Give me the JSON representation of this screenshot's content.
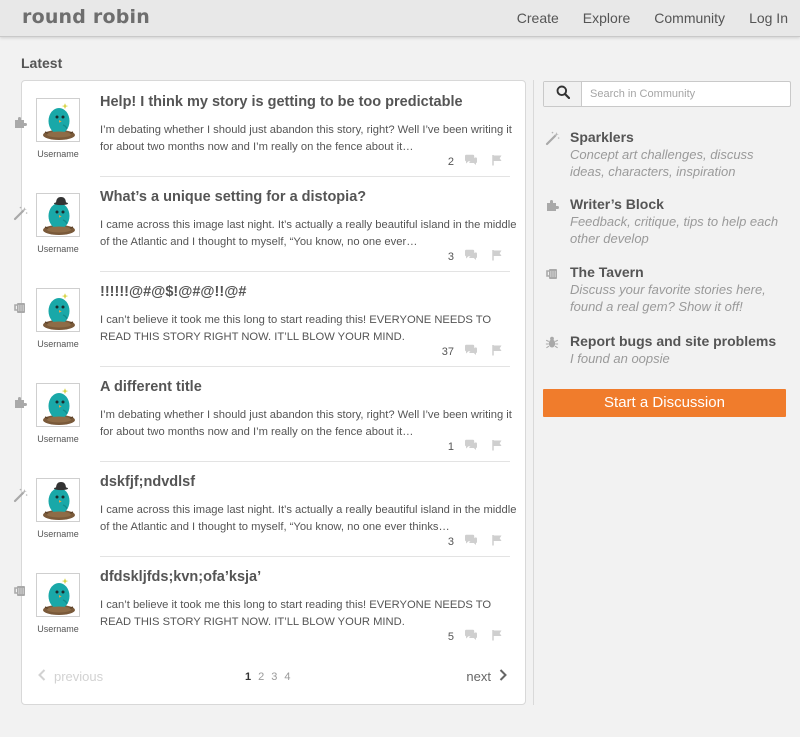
{
  "header": {
    "logo": "round robin",
    "nav": [
      "Create",
      "Explore",
      "Community",
      "Log In"
    ]
  },
  "section_title": "Latest",
  "posts": [
    {
      "category_icon": "puzzle-icon",
      "avatar_hat": "none",
      "username": "Username",
      "title": "Help! I think my story is getting to be too predictable",
      "excerpt": "I’m debating whether I should just abandon this story, right? Well I’ve been writing it for about two months now and I’m really on the fence about it…",
      "comments": "2"
    },
    {
      "category_icon": "wand-icon",
      "avatar_hat": "bowler",
      "username": "Username",
      "title": "What’s a unique setting for a distopia?",
      "excerpt": "I came across this image last night. It’s actually a really beautiful island in the middle of the Atlantic and I thought to myself, “You know, no one ever…",
      "comments": "3"
    },
    {
      "category_icon": "mug-icon",
      "avatar_hat": "none",
      "username": "Username",
      "title": "!!!!!!@#@$!@#@!!@#",
      "excerpt": "I can’t believe it took me this long to start reading this! EVERYONE NEEDS TO READ THIS STORY RIGHT NOW. IT’LL BLOW YOUR MIND.",
      "comments": "37"
    },
    {
      "category_icon": "puzzle-icon",
      "avatar_hat": "none",
      "username": "Username",
      "title": "A different title",
      "excerpt": "I’m debating whether I should just abandon this story, right? Well I’ve been writing it for about two months now and I’m really on the fence about it…",
      "comments": "1"
    },
    {
      "category_icon": "wand-icon",
      "avatar_hat": "bowler",
      "username": "Username",
      "title": "dskfjf;ndvdlsf",
      "excerpt": "I came across this image last night. It’s actually a really beautiful island in the middle of the Atlantic and I thought to myself, “You know, no one ever thinks…",
      "comments": "3"
    },
    {
      "category_icon": "mug-icon",
      "avatar_hat": "none",
      "username": "Username",
      "title": "dfdskljfds;kvn;ofa’ksja’",
      "excerpt": "I can’t believe it took me this long to start reading this! EVERYONE NEEDS TO READ THIS STORY RIGHT NOW. IT’LL BLOW YOUR MIND.",
      "comments": "5"
    }
  ],
  "pagination": {
    "previous": "previous",
    "next": "next",
    "pages": [
      "1",
      "2",
      "3",
      "4"
    ],
    "current": "1"
  },
  "search": {
    "placeholder": "Search in Community"
  },
  "categories": [
    {
      "icon": "wand-icon",
      "name": "Sparklers",
      "description": "Concept art challenges, discuss ideas, characters, inspiration"
    },
    {
      "icon": "puzzle-icon",
      "name": "Writer’s Block",
      "description": "Feedback, critique, tips to help each other develop"
    },
    {
      "icon": "mug-icon",
      "name": "The Tavern",
      "description": "Discuss your favorite stories here, found a real gem? Show it off!"
    },
    {
      "icon": "bug-icon",
      "name": "Report bugs and site problems",
      "description": "I found an oopsie"
    }
  ],
  "start_button": "Start a Discussion",
  "colors": {
    "accent": "#f07c2c",
    "bird": "#19a8a8",
    "nest": "#7a5a3a",
    "header_bg": "#e8e8e8",
    "page_bg": "#f2f2f2"
  }
}
